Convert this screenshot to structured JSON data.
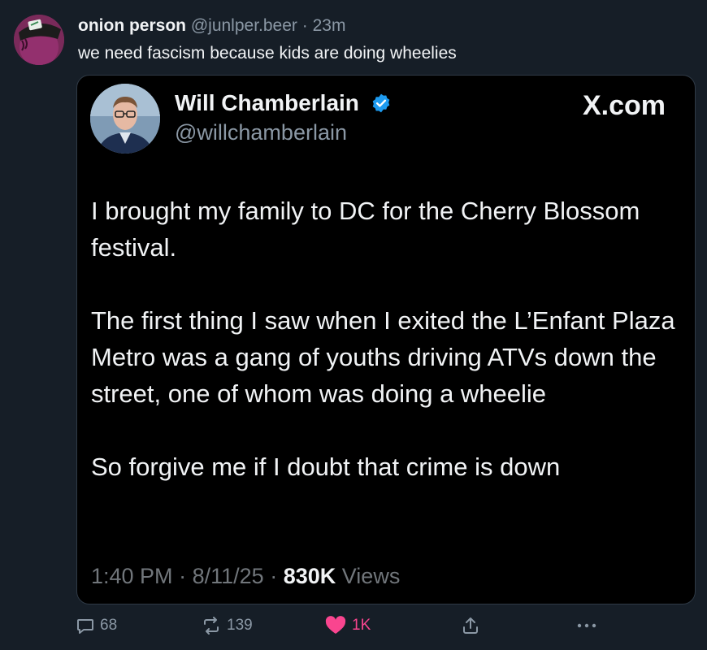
{
  "post": {
    "display_name": "onion person",
    "handle": "@junlper.beer",
    "separator": "·",
    "time": "23m",
    "text": "we need fascism because kids are doing wheelies"
  },
  "embed": {
    "name": "Will Chamberlain",
    "handle": "@willchamberlain",
    "source": "X.com",
    "paragraphs": [
      "I brought my family to DC for the Cherry Blossom festival.",
      "The first thing I saw when I exited the L’Enfant Plaza Metro was a gang of youths driving ATVs down the street, one of whom was doing a wheelie",
      "So forgive me if I doubt that crime is down"
    ],
    "time": "1:40 PM",
    "date": "8/11/25",
    "separator": "·",
    "views_count": "830K",
    "views_label": "Views"
  },
  "actions": {
    "replies": "68",
    "reposts": "139",
    "likes": "1K"
  },
  "colors": {
    "background": "#161e27",
    "embed_background": "#000000",
    "like": "#f9458f",
    "verified": "#1d9bf0",
    "muted": "#8b98a5"
  },
  "icons": [
    "reply-icon",
    "repost-icon",
    "heart-icon",
    "share-icon",
    "more-icon",
    "verified-badge-icon"
  ]
}
